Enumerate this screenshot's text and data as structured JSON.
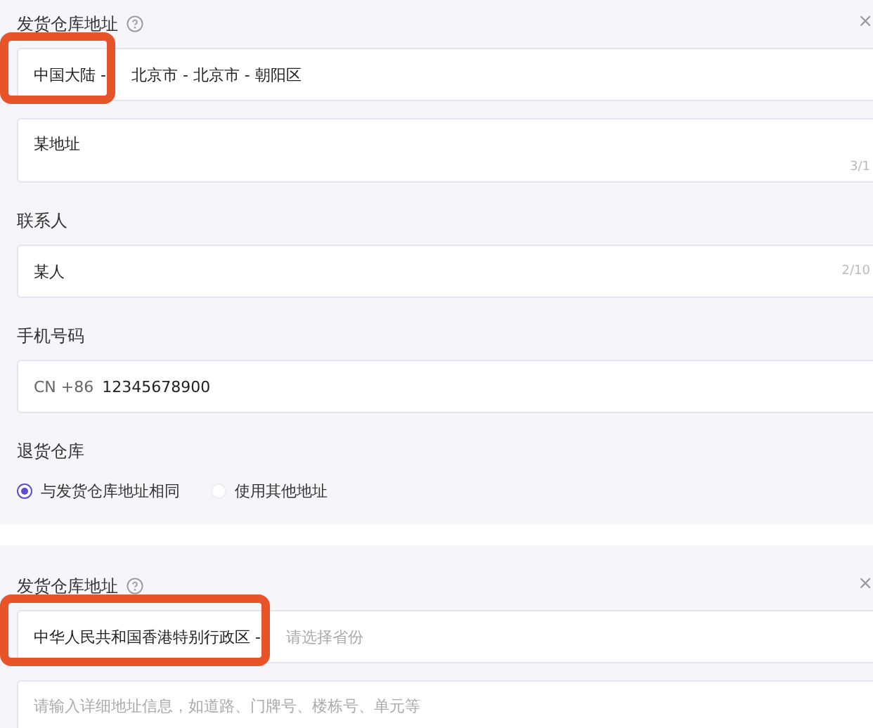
{
  "sections": [
    {
      "label": "发货仓库地址",
      "close": "×",
      "region": {
        "value_parts": [
          {
            "text": "中国大陆 -",
            "highlighted": true
          },
          {
            "text": "北京市 - 北京市 - 朝阳区",
            "highlighted": false
          }
        ]
      },
      "address": {
        "value": "某地址",
        "counter": "3/1"
      },
      "contact": {
        "label": "联系人",
        "value": "某人",
        "counter": "2/10"
      },
      "phone": {
        "label": "手机号码",
        "prefix": "CN +86",
        "value": "12345678900"
      },
      "return": {
        "label": "退货仓库",
        "options": [
          {
            "label": "与发货仓库地址相同",
            "selected": true
          },
          {
            "label": "使用其他地址",
            "selected": false
          }
        ]
      }
    },
    {
      "label": "发货仓库地址",
      "close": "×",
      "region": {
        "value_parts": [
          {
            "text": "中华人民共和国香港特别行政区 -",
            "highlighted": true
          }
        ],
        "placeholder": "请选择省份"
      },
      "address": {
        "placeholder": "请输入详细地址信息，如道路、门牌号、楼栋号、单元等"
      }
    }
  ]
}
